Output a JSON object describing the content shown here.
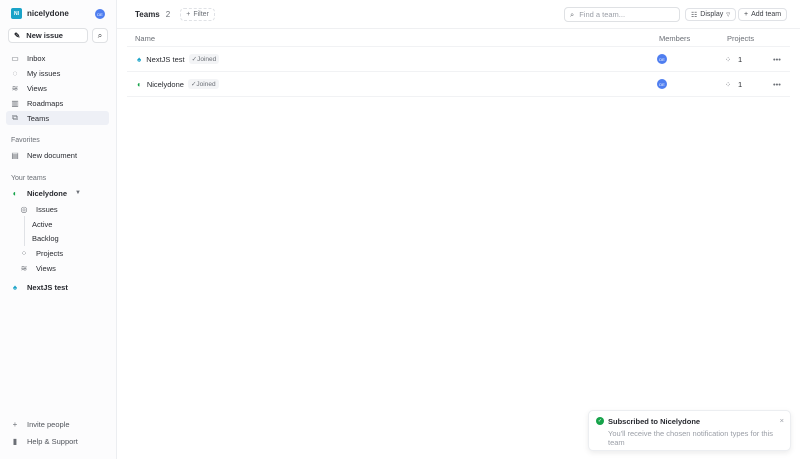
{
  "workspace": {
    "name": "nicelydone",
    "logo": "NI",
    "avatar": "DE"
  },
  "sidebar": {
    "new_issue": "New issue",
    "items": [
      {
        "label": "Inbox",
        "icon": "inbox-icon"
      },
      {
        "label": "My issues",
        "icon": "target-icon"
      },
      {
        "label": "Views",
        "icon": "layers-icon"
      },
      {
        "label": "Roadmaps",
        "icon": "map-icon"
      },
      {
        "label": "Teams",
        "icon": "teams-icon"
      }
    ],
    "favorites_heading": "Favorites",
    "favorites": [
      "New document"
    ],
    "teams_heading": "Your teams",
    "team": "Nicelydone",
    "team_items": [
      "Issues",
      "Active",
      "Backlog",
      "Projects",
      "Views"
    ],
    "team2": "NextJS test",
    "invite": "Invite people",
    "help": "Help & Support"
  },
  "header": {
    "title": "Teams",
    "count": "2",
    "filter": "Filter",
    "search_placeholder": "Find a team...",
    "display": "Display",
    "add_team": "Add team"
  },
  "table": {
    "columns": [
      "Name",
      "Members",
      "Projects"
    ],
    "rows": [
      {
        "name": "NextJS test",
        "badge": "Joined",
        "member": "DE",
        "projects": "1"
      },
      {
        "name": "Nicelydone",
        "badge": "Joined",
        "member": "DE",
        "projects": "1"
      }
    ]
  },
  "toast": {
    "title": "Subscribed to Nicelydone",
    "body": "You'll receive the chosen notification types for this team"
  },
  "colors": {
    "accent": "#4f7ef0",
    "success": "#16a34a"
  }
}
